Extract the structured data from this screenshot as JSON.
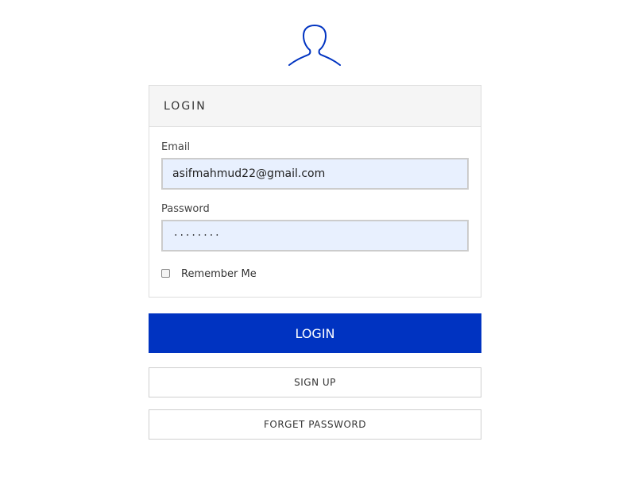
{
  "icon": {
    "name": "user-icon",
    "color": "#0033c1"
  },
  "panel": {
    "title": "LOGIN",
    "email": {
      "label": "Email",
      "value": "asifmahmud22@gmail.com"
    },
    "password": {
      "label": "Password",
      "masked_value": "········"
    },
    "remember": {
      "label": "Remember Me",
      "checked": false
    }
  },
  "buttons": {
    "login": "LOGIN",
    "signup": "SIGN UP",
    "forget": "FORGET PASSWORD"
  },
  "colors": {
    "accent": "#0033c1",
    "input_autofill_bg": "#e8f0fe",
    "panel_header_bg": "#f5f5f5"
  }
}
